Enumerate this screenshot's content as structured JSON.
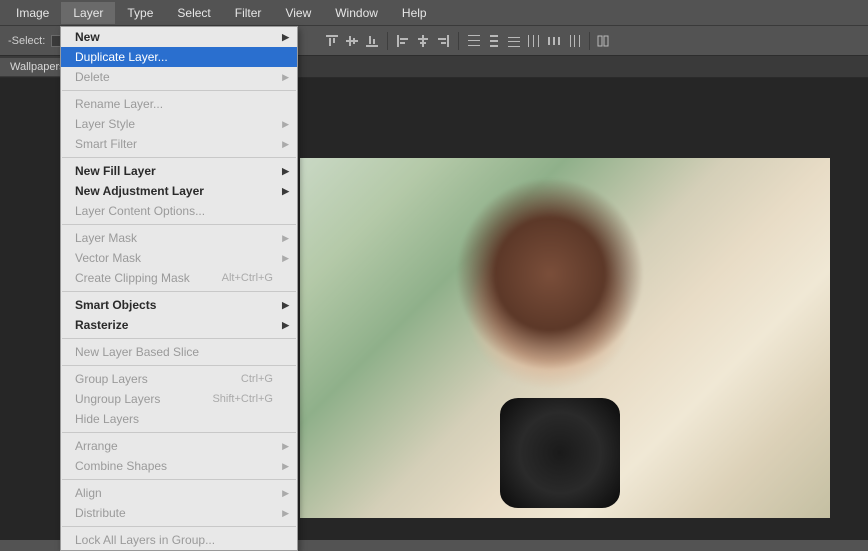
{
  "menubar": {
    "items": [
      "Image",
      "Layer",
      "Type",
      "Select",
      "Filter",
      "View",
      "Window",
      "Help"
    ],
    "active_index": 1
  },
  "toolbar": {
    "select_label": "-Select:"
  },
  "tab": {
    "label": "Wallpapers"
  },
  "dropdown": {
    "groups": [
      [
        {
          "label": "New",
          "submenu": true,
          "bold": true
        },
        {
          "label": "Duplicate Layer...",
          "highlighted": true
        },
        {
          "label": "Delete",
          "submenu": true,
          "disabled": true
        }
      ],
      [
        {
          "label": "Rename Layer...",
          "disabled": true
        },
        {
          "label": "Layer Style",
          "submenu": true,
          "disabled": true
        },
        {
          "label": "Smart Filter",
          "submenu": true,
          "disabled": true
        }
      ],
      [
        {
          "label": "New Fill Layer",
          "submenu": true,
          "bold": true
        },
        {
          "label": "New Adjustment Layer",
          "submenu": true,
          "bold": true
        },
        {
          "label": "Layer Content Options...",
          "disabled": true
        }
      ],
      [
        {
          "label": "Layer Mask",
          "submenu": true,
          "disabled": true
        },
        {
          "label": "Vector Mask",
          "submenu": true,
          "disabled": true
        },
        {
          "label": "Create Clipping Mask",
          "shortcut": "Alt+Ctrl+G",
          "disabled": true
        }
      ],
      [
        {
          "label": "Smart Objects",
          "submenu": true,
          "bold": true
        },
        {
          "label": "Rasterize",
          "submenu": true,
          "bold": true
        }
      ],
      [
        {
          "label": "New Layer Based Slice",
          "disabled": true
        }
      ],
      [
        {
          "label": "Group Layers",
          "shortcut": "Ctrl+G",
          "disabled": true
        },
        {
          "label": "Ungroup Layers",
          "shortcut": "Shift+Ctrl+G",
          "disabled": true
        },
        {
          "label": "Hide Layers",
          "disabled": true
        }
      ],
      [
        {
          "label": "Arrange",
          "submenu": true,
          "disabled": true
        },
        {
          "label": "Combine Shapes",
          "submenu": true,
          "disabled": true
        }
      ],
      [
        {
          "label": "Align",
          "submenu": true,
          "disabled": true
        },
        {
          "label": "Distribute",
          "submenu": true,
          "disabled": true
        }
      ],
      [
        {
          "label": "Lock All Layers in Group...",
          "disabled": true
        }
      ]
    ]
  }
}
